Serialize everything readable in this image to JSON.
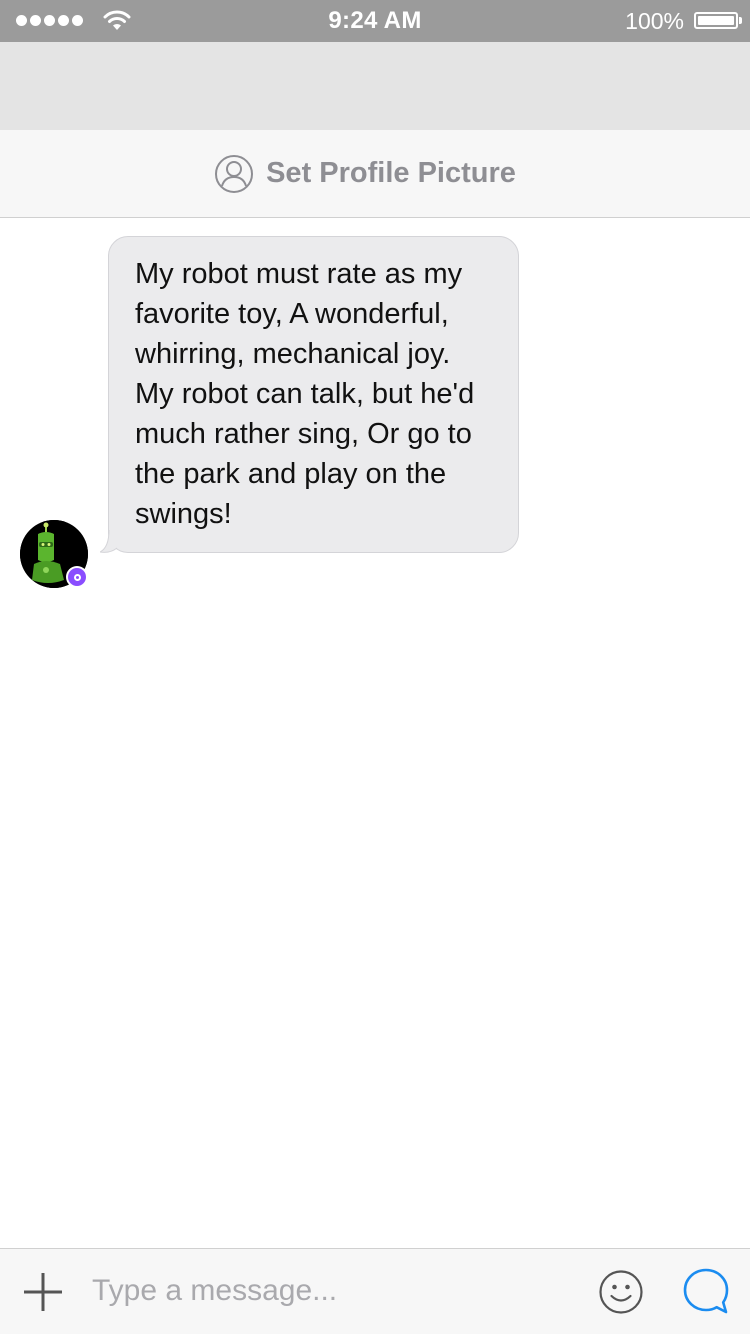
{
  "status_bar": {
    "time": "9:24 AM",
    "battery_percent": "100%",
    "signal_icon": "signal-dots-icon",
    "wifi_icon": "wifi-icon",
    "battery_icon": "battery-icon"
  },
  "profile_bar": {
    "icon": "person-circle-icon",
    "label": "Set Profile Picture"
  },
  "messages": [
    {
      "text": "My robot must rate as my favorite toy,  A wonderful, whirring, mechanical joy.  My robot can talk, but he'd much rather sing,  Or go to the park and play on the swings!",
      "avatar_icon": "robot-avatar-icon",
      "badge_icon": "bot-badge-icon"
    }
  ],
  "composer": {
    "add_icon": "plus-icon",
    "placeholder": "Type a message...",
    "emoji_icon": "smiley-icon",
    "send_icon": "chat-bubble-icon"
  },
  "colors": {
    "status_bar": "#9b9b9b",
    "nav_header": "#e4e4e4",
    "bubble": "#ebebed",
    "accent": "#1b8cf0",
    "badge": "#8a4dff"
  }
}
